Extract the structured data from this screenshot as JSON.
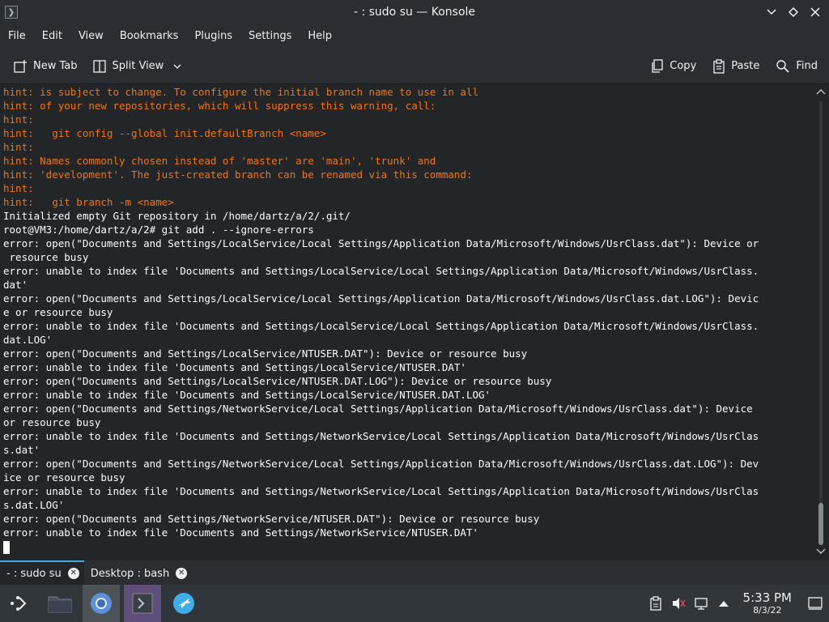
{
  "window": {
    "title": "- : sudo su — Konsole"
  },
  "menu": [
    "File",
    "Edit",
    "View",
    "Bookmarks",
    "Plugins",
    "Settings",
    "Help"
  ],
  "toolbar": {
    "new_tab": "New Tab",
    "split_view": "Split View",
    "copy": "Copy",
    "paste": "Paste",
    "find": "Find"
  },
  "terminal": {
    "lines": [
      {
        "text": "hint: is subject to change. To configure the initial branch name to use in all",
        "kind": "hint"
      },
      {
        "text": "hint: of your new repositories, which will suppress this warning, call:",
        "kind": "hint"
      },
      {
        "text": "hint:",
        "kind": "hint"
      },
      {
        "text": "hint:   git config --global init.defaultBranch <name>",
        "kind": "hint"
      },
      {
        "text": "hint:",
        "kind": "hint"
      },
      {
        "text": "hint: Names commonly chosen instead of 'master' are 'main', 'trunk' and",
        "kind": "hint"
      },
      {
        "text": "hint: 'development'. The just-created branch can be renamed via this command:",
        "kind": "hint"
      },
      {
        "text": "hint:",
        "kind": "hint"
      },
      {
        "text": "hint:   git branch -m <name>",
        "kind": "hint"
      },
      {
        "text": "Initialized empty Git repository in /home/dartz/a/2/.git/",
        "kind": "normal"
      },
      {
        "text": "root@VM3:/home/dartz/a/2# git add . --ignore-errors",
        "kind": "normal"
      },
      {
        "text": "error: open(\"Documents and Settings/LocalService/Local Settings/Application Data/Microsoft/Windows/UsrClass.dat\"): Device or",
        "kind": "normal"
      },
      {
        "text": " resource busy",
        "kind": "normal"
      },
      {
        "text": "error: unable to index file 'Documents and Settings/LocalService/Local Settings/Application Data/Microsoft/Windows/UsrClass.",
        "kind": "normal"
      },
      {
        "text": "dat'",
        "kind": "normal"
      },
      {
        "text": "error: open(\"Documents and Settings/LocalService/Local Settings/Application Data/Microsoft/Windows/UsrClass.dat.LOG\"): Devic",
        "kind": "normal"
      },
      {
        "text": "e or resource busy",
        "kind": "normal"
      },
      {
        "text": "error: unable to index file 'Documents and Settings/LocalService/Local Settings/Application Data/Microsoft/Windows/UsrClass.",
        "kind": "normal"
      },
      {
        "text": "dat.LOG'",
        "kind": "normal"
      },
      {
        "text": "error: open(\"Documents and Settings/LocalService/NTUSER.DAT\"): Device or resource busy",
        "kind": "normal"
      },
      {
        "text": "error: unable to index file 'Documents and Settings/LocalService/NTUSER.DAT'",
        "kind": "normal"
      },
      {
        "text": "error: open(\"Documents and Settings/LocalService/NTUSER.DAT.LOG\"): Device or resource busy",
        "kind": "normal"
      },
      {
        "text": "error: unable to index file 'Documents and Settings/LocalService/NTUSER.DAT.LOG'",
        "kind": "normal"
      },
      {
        "text": "error: open(\"Documents and Settings/NetworkService/Local Settings/Application Data/Microsoft/Windows/UsrClass.dat\"): Device",
        "kind": "normal"
      },
      {
        "text": "or resource busy",
        "kind": "normal"
      },
      {
        "text": "error: unable to index file 'Documents and Settings/NetworkService/Local Settings/Application Data/Microsoft/Windows/UsrClas",
        "kind": "normal"
      },
      {
        "text": "s.dat'",
        "kind": "normal"
      },
      {
        "text": "error: open(\"Documents and Settings/NetworkService/Local Settings/Application Data/Microsoft/Windows/UsrClass.dat.LOG\"): Dev",
        "kind": "normal"
      },
      {
        "text": "ice or resource busy",
        "kind": "normal"
      },
      {
        "text": "error: unable to index file 'Documents and Settings/NetworkService/Local Settings/Application Data/Microsoft/Windows/UsrClas",
        "kind": "normal"
      },
      {
        "text": "s.dat.LOG'",
        "kind": "normal"
      },
      {
        "text": "error: open(\"Documents and Settings/NetworkService/NTUSER.DAT\"): Device or resource busy",
        "kind": "normal"
      },
      {
        "text": "error: unable to index file 'Documents and Settings/NetworkService/NTUSER.DAT'",
        "kind": "normal"
      }
    ]
  },
  "tabs": [
    {
      "label": "- : sudo su",
      "active": true
    },
    {
      "label": "Desktop : bash",
      "active": false
    }
  ],
  "taskbar": {
    "clock_time": "5:33 PM",
    "clock_date": "8/3/22"
  },
  "colors": {
    "hint": "#f67400",
    "accent": "#3daee9",
    "background": "#232629"
  }
}
